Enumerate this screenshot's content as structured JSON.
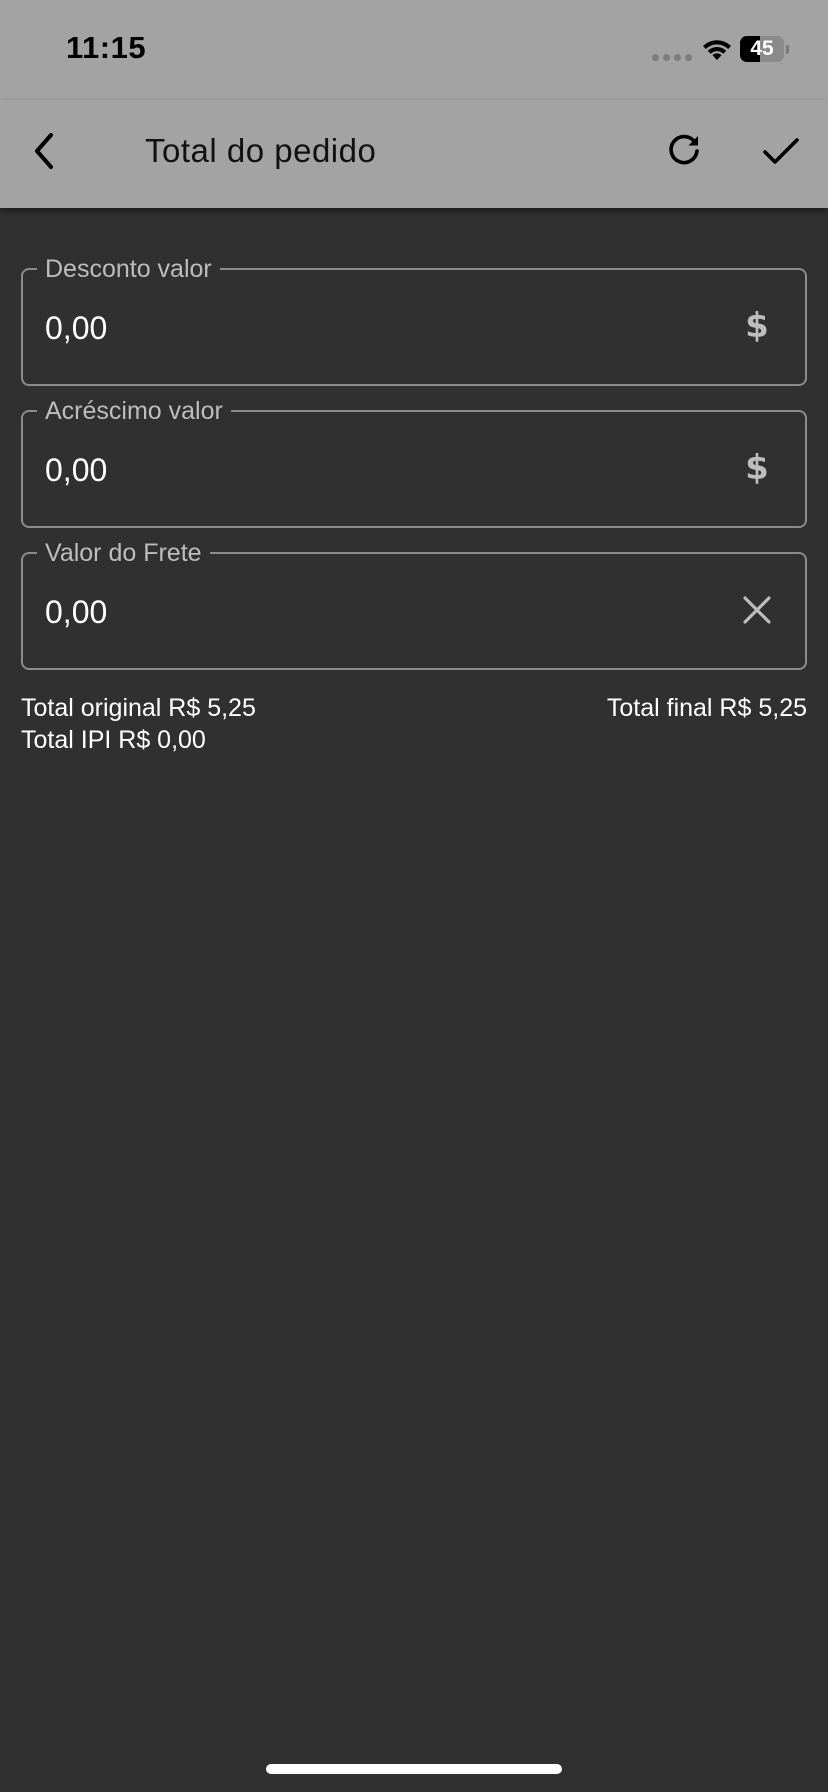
{
  "status_bar": {
    "time": "11:15",
    "battery_level": "45",
    "battery_fraction": 0.45
  },
  "header": {
    "title": "Total do pedido",
    "back_icon": "chevron-left-icon",
    "refresh_icon": "refresh-icon",
    "confirm_icon": "check-icon"
  },
  "form": {
    "fields": [
      {
        "label": "Desconto valor",
        "value": "0,00",
        "icon": "dollar-icon",
        "icon_glyph": "$"
      },
      {
        "label": "Acréscimo valor",
        "value": "0,00",
        "icon": "dollar-icon",
        "icon_glyph": "$"
      },
      {
        "label": "Valor do Frete",
        "value": "0,00",
        "icon": "clear-icon"
      }
    ]
  },
  "totals": {
    "original": "Total original R$ 5,25",
    "ipi": "Total IPI R$ 0,00",
    "final": "Total final R$ 5,25"
  },
  "colors": {
    "app_bar": "#a3a3a3",
    "background": "#303030",
    "field_border": "#8b8b8b",
    "label_text": "#bdbdbd"
  }
}
